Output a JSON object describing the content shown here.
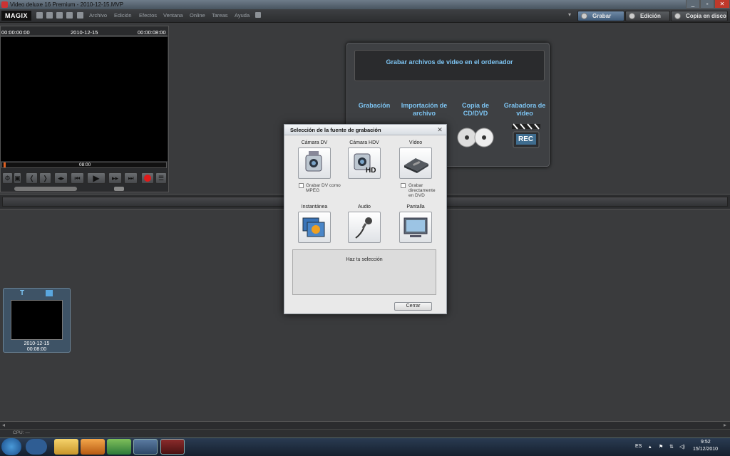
{
  "window": {
    "title": "Video deluxe 16 Premium - 2010-12-15.MVP",
    "minimize": "_",
    "maximize": "▫",
    "close": "✕"
  },
  "menubar": {
    "logo": "MAGIX",
    "items": [
      "Archivo",
      "Edición",
      "Efectos",
      "Ventana",
      "Online",
      "Tareas",
      "Ayuda"
    ],
    "modes": {
      "grabar": "Grabar",
      "edicion": "Edición",
      "copia": "Copia en disco"
    }
  },
  "preview": {
    "timecode_left": "00:00:00:00",
    "date": "2010-12-15",
    "timecode_right": "00:00:08:00",
    "bar_time": "08:00"
  },
  "record_panel": {
    "header": "Grabar archivos de video en el ordenador",
    "options": [
      "Grabación",
      "Importación de archivo",
      "Copia de CD/DVD",
      "Grabadora de vídeo"
    ],
    "rec_label": "REC"
  },
  "clip": {
    "date": "2010-12-15",
    "duration": "00:08:00"
  },
  "status": {
    "cpu": "CPU: —"
  },
  "dialog": {
    "title": "Selección de la fuente de grabación",
    "sources": {
      "camara_dv": "Cámara DV",
      "camara_hdv": "Cámara HDV",
      "video": "Vídeo",
      "instantanea": "Instantánea",
      "audio": "Audio",
      "pantalla": "Pantalla"
    },
    "hd_label": "HD",
    "check_dv": "Grabar DV como MPEG",
    "check_video": "Grabar directamente en DVD",
    "info": "Haz tu selección",
    "close_button": "Cerrar"
  },
  "taskbar": {
    "lang": "ES",
    "time": "9:52",
    "date": "15/12/2010"
  }
}
